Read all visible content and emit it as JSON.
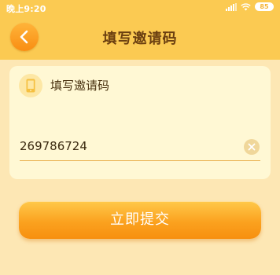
{
  "status_bar": {
    "time": "晚上9:20",
    "battery": "85",
    "icons": [
      "signal-icon",
      "wifi-icon",
      "battery-icon"
    ]
  },
  "header": {
    "title": "填写邀请码",
    "back_icon": "chevron-left-icon"
  },
  "card": {
    "icon": "phone-icon",
    "label": "填写邀请码",
    "input_value": "269786724",
    "clear_icon": "close-icon"
  },
  "submit": {
    "label": "立即提交"
  },
  "colors": {
    "page_background": "#fde7b4",
    "header_background": "#fbca52",
    "card_background": "#fff8d4",
    "accent_orange": "#fba21f",
    "title_text": "#6b3f10"
  }
}
